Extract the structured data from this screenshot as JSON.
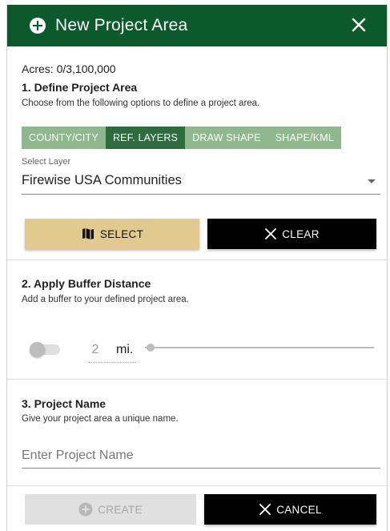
{
  "dialog": {
    "title": "New Project Area",
    "header_color": "#0c5a2b"
  },
  "acres": "Acres: 0/3,100,000",
  "section1": {
    "title": "1. Define Project Area",
    "subtitle": "Choose from the following options to define a project area.",
    "tabs": [
      {
        "label": "COUNTY/CITY",
        "active": false
      },
      {
        "label": "REF. LAYERS",
        "active": true
      },
      {
        "label": "DRAW SHAPE",
        "active": false
      },
      {
        "label": "SHAPE/KML",
        "active": false
      }
    ],
    "select_label": "Select Layer",
    "select_value": "Firewise USA Communities",
    "select_button": "SELECT",
    "clear_button": "CLEAR"
  },
  "section2": {
    "title": "2. Apply Buffer Distance",
    "subtitle": "Add a buffer to your defined project area.",
    "buffer_enabled": false,
    "buffer_value": "2",
    "buffer_unit": "mi.",
    "slider_fraction": 0
  },
  "section3": {
    "title": "3. Project Name",
    "subtitle": "Give your project area a unique name.",
    "name_placeholder": "Enter Project Name"
  },
  "footer": {
    "create_button": "CREATE",
    "cancel_button": "CANCEL"
  },
  "colors": {
    "tab_inactive": "#8fb88f",
    "tab_active": "#2e6b3d",
    "select_button_bg": "#e2c98e",
    "dark_button_bg": "#000000",
    "disabled_button_bg": "#e0e0e0"
  }
}
